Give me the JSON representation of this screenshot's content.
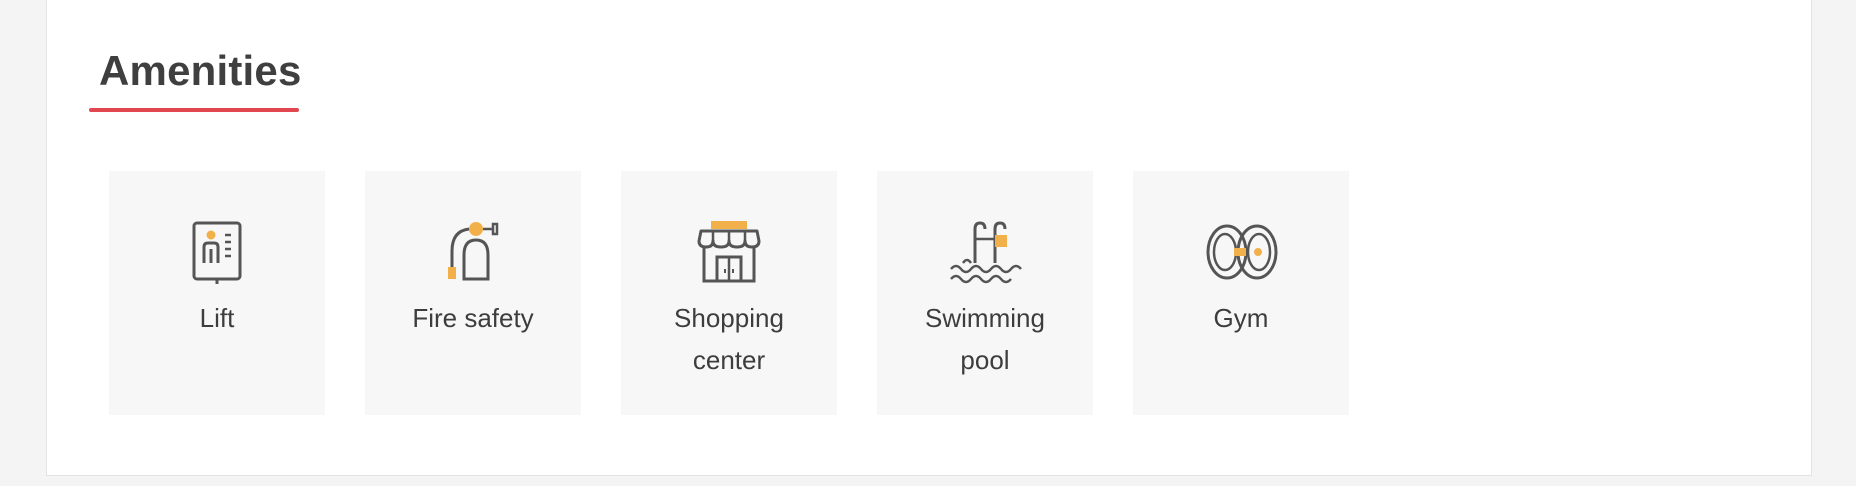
{
  "section": {
    "title": "Amenities",
    "accent_color": "#e2474f"
  },
  "colors": {
    "icon_stroke": "#555555",
    "icon_accent": "#f2b04a",
    "tile_background": "#f7f7f7"
  },
  "amenities": [
    {
      "label": "Lift",
      "icon": "lift-icon"
    },
    {
      "label": "Fire safety",
      "icon": "fire-extinguisher-icon"
    },
    {
      "label": "Shopping center",
      "icon": "storefront-icon"
    },
    {
      "label": "Swimming pool",
      "icon": "swimming-pool-icon"
    },
    {
      "label": "Gym",
      "icon": "dumbbell-icon"
    }
  ]
}
